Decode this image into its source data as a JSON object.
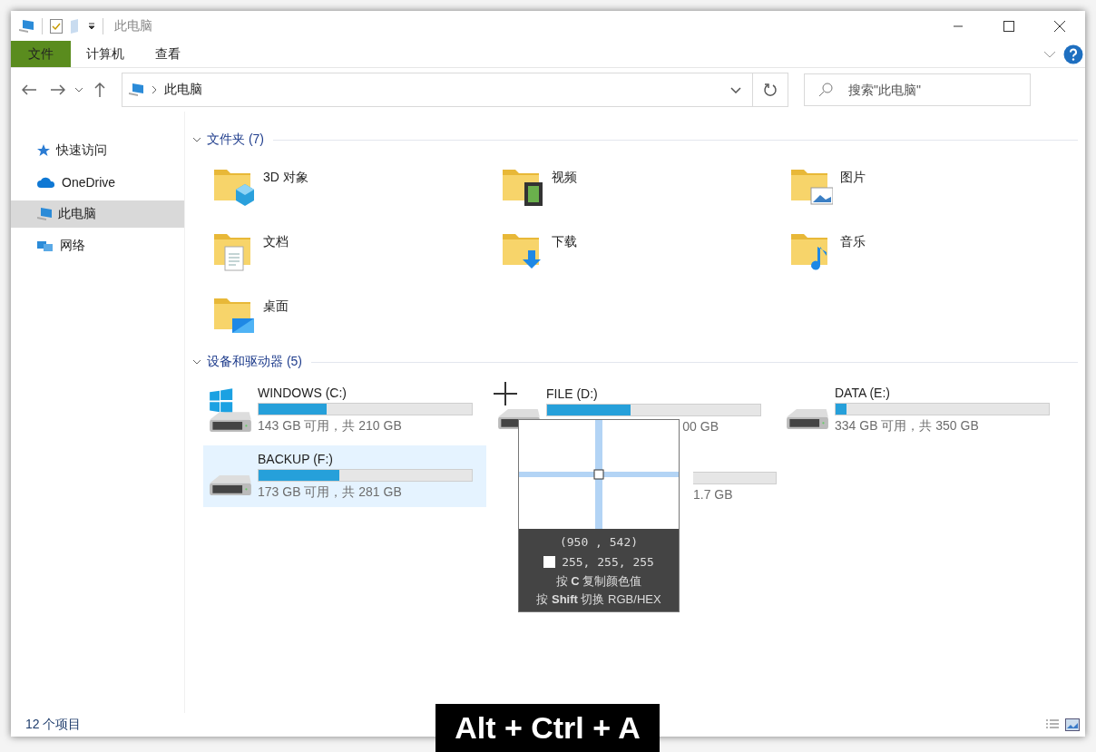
{
  "window": {
    "title": "此电脑"
  },
  "ribbon": {
    "tabs": [
      {
        "label": "文件",
        "kind": "file"
      },
      {
        "label": "计算机",
        "kind": "tab"
      },
      {
        "label": "查看",
        "kind": "tab"
      }
    ]
  },
  "address": {
    "path": "此电脑",
    "search_placeholder": "搜索\"此电脑\""
  },
  "sidebar": {
    "items": [
      {
        "label": "快速访问",
        "kind": "star",
        "selected": false
      },
      {
        "label": "OneDrive",
        "kind": "cloud",
        "selected": false
      },
      {
        "label": "此电脑",
        "kind": "pc",
        "selected": true
      },
      {
        "label": "网络",
        "kind": "network",
        "selected": false
      }
    ]
  },
  "folders": {
    "header": "文件夹 (7)",
    "items": [
      {
        "name": "3D 对象",
        "kind": "cube"
      },
      {
        "name": "视频",
        "kind": "video"
      },
      {
        "name": "图片",
        "kind": "pictures"
      },
      {
        "name": "文档",
        "kind": "documents"
      },
      {
        "name": "下载",
        "kind": "downloads"
      },
      {
        "name": "音乐",
        "kind": "music"
      },
      {
        "name": "桌面",
        "kind": "desktop"
      }
    ]
  },
  "drives": {
    "header": "设备和驱动器 (5)",
    "items": [
      {
        "name": "WINDOWS (C:)",
        "kind": "system",
        "level": 0.32,
        "usage": "143 GB 可用，共 210 GB",
        "selected": false
      },
      {
        "name": "FILE (D:)",
        "kind": "covered",
        "level": 0.39,
        "usage": "00 GB",
        "selected": false
      },
      {
        "name": "DATA (E:)",
        "kind": "disk",
        "level": 0.05,
        "usage": "334 GB 可用，共 350 GB",
        "selected": false
      },
      {
        "name": "BACKUP (F:)",
        "kind": "disk",
        "level": 0.38,
        "usage": "173 GB 可用，共 281 GB",
        "selected": true
      },
      {
        "kind": "hidden",
        "usage": "1.7 GB"
      }
    ]
  },
  "status_bar": {
    "count": "12 个项目"
  },
  "color_picker": {
    "coords": "(950 , 542)",
    "rgb": "255, 255, 255",
    "hint_copy": "按 **C** 复制颜色值",
    "hint_switch": "按 **Shift** 切换 RGB/HEX"
  },
  "key_caption": "Alt + Ctrl + A"
}
